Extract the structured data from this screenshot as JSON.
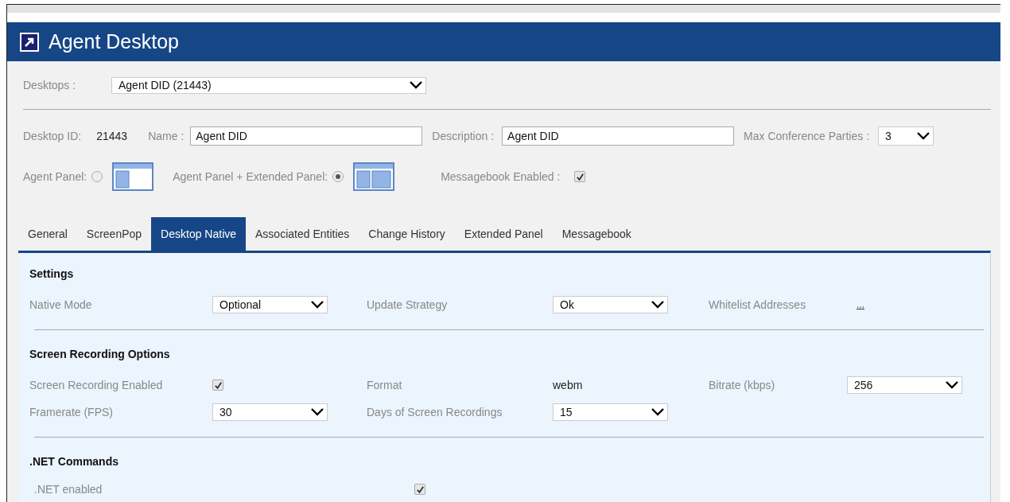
{
  "header": {
    "title": "Agent Desktop"
  },
  "desktops": {
    "label": "Desktops :",
    "value": "Agent DID (21443)"
  },
  "details": {
    "id_label": "Desktop ID:",
    "id_value": "21443",
    "name": {
      "label": "Name :",
      "value": "Agent DID"
    },
    "description": {
      "label": "Description :",
      "value": "Agent DID"
    },
    "max_parties": {
      "label": "Max Conference Parties :",
      "value": "3"
    }
  },
  "panel_options": [
    {
      "label": "Agent Panel:",
      "kind": "single",
      "selected": false
    },
    {
      "label": "Agent Panel + Extended Panel:",
      "kind": "double",
      "selected": true
    }
  ],
  "messagebook": {
    "label": "Messagebook Enabled :",
    "checked": true
  },
  "tabs": [
    {
      "label": "General",
      "selected": false
    },
    {
      "label": "ScreenPop",
      "selected": false
    },
    {
      "label": "Desktop Native",
      "selected": true
    },
    {
      "label": "Associated Entities",
      "selected": false
    },
    {
      "label": "Change History",
      "selected": false
    },
    {
      "label": "Extended Panel",
      "selected": false
    },
    {
      "label": "Messagebook",
      "selected": false
    }
  ],
  "sections": [
    {
      "title": "Settings",
      "kind": "grid",
      "rows": [
        [
          {
            "label": "Native Mode",
            "kind": "select",
            "value": "Optional"
          },
          {
            "label": "Update Strategy",
            "kind": "select",
            "value": "Ok"
          },
          {
            "label": "Whitelist Addresses",
            "kind": "link",
            "value": "..."
          }
        ]
      ]
    },
    {
      "title": "Screen Recording Options",
      "kind": "grid",
      "rows": [
        [
          {
            "label": "Screen Recording Enabled",
            "kind": "checkbox",
            "checked": true
          },
          {
            "label": "Format",
            "kind": "text",
            "value": "webm"
          },
          {
            "label": "Bitrate (kbps)",
            "kind": "select",
            "value": "256"
          }
        ],
        [
          {
            "label": "Framerate (FPS)",
            "kind": "select",
            "value": "30"
          },
          {
            "label": "Days of Screen Recordings",
            "kind": "select",
            "value": "15"
          }
        ]
      ]
    },
    {
      "title": ".NET Commands",
      "kind": "wide",
      "rows": [
        [
          {
            "label": ".NET enabled",
            "kind": "checkbox",
            "checked": true
          }
        ]
      ]
    }
  ]
}
